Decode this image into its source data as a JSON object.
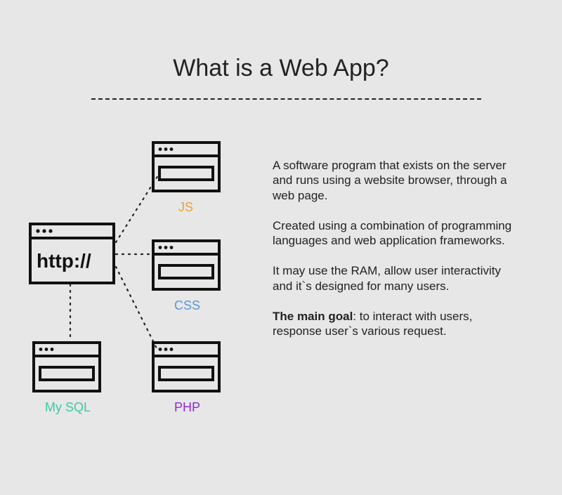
{
  "title": "What is a Web App?",
  "diagram": {
    "main_label": "http://",
    "nodes": {
      "js": {
        "label": "JS",
        "color": "#e8a23a"
      },
      "css": {
        "label": "CSS",
        "color": "#5a97d6"
      },
      "php": {
        "label": "PHP",
        "color": "#8a2be2"
      },
      "mysql": {
        "label": "My SQL",
        "color": "#3fc9a4"
      }
    }
  },
  "paragraphs": {
    "p1": "A software program that exists on the server and runs using a website browser, through a web page.",
    "p2": "Created using a combination of programming languages and web application frameworks.",
    "p3": "It may use the RAM, allow user interactivity and it`s designed for many users.",
    "p4_bold": "The main goal",
    "p4_rest": ": to interact with users, response user`s various request."
  }
}
